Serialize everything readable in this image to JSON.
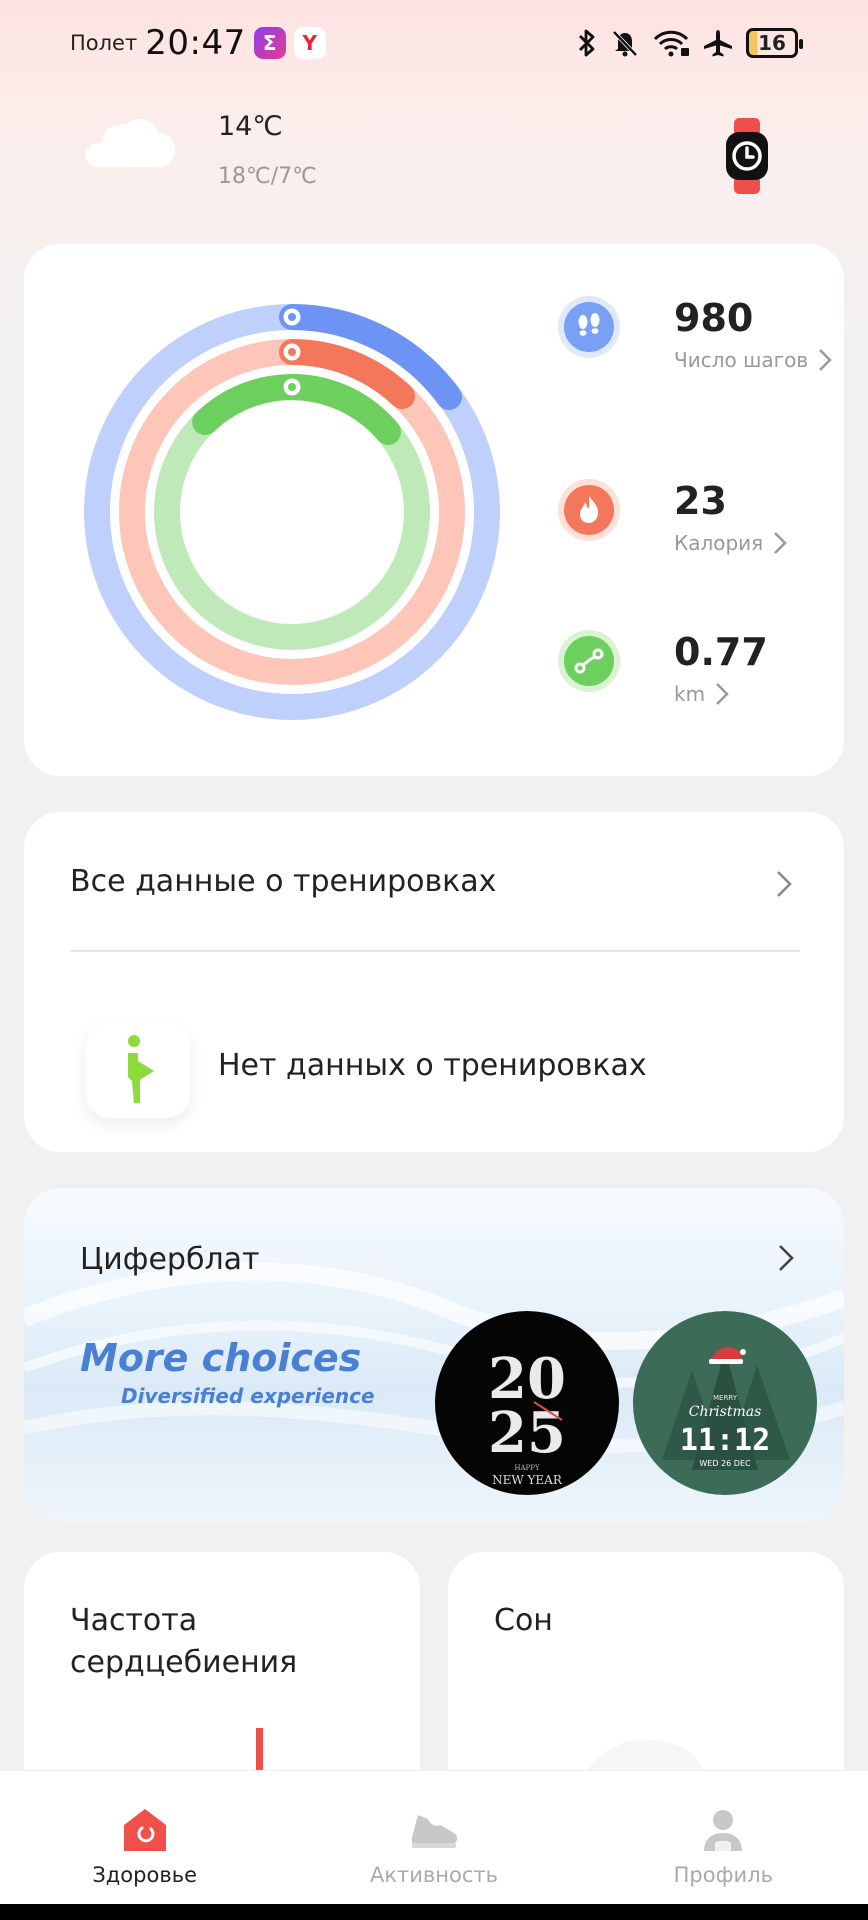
{
  "status_bar": {
    "carrier": "Полет",
    "time": "20:47",
    "app_badge_1": "Σ",
    "app_badge_2": "Y",
    "battery": "16"
  },
  "weather": {
    "current_temp": "14℃",
    "range": "18℃/7℃",
    "icon": "cloud-icon"
  },
  "activity": {
    "steps": {
      "value": "980",
      "label": "Число шагов",
      "icon": "footsteps-icon",
      "color": "#6d93f5"
    },
    "calories": {
      "value": "23",
      "label": "Калория",
      "icon": "flame-icon",
      "color": "#f4775c"
    },
    "distance": {
      "value": "0.77",
      "label": "km",
      "icon": "route-icon",
      "color": "#6ccf5e"
    }
  },
  "workouts": {
    "title": "Все данные о тренировках",
    "empty_text": "Нет данных о тренировках"
  },
  "watchface": {
    "title": "Циферблат",
    "promo_title": "More choices",
    "promo_subtitle": "Diversified experience",
    "face1": {
      "line1": "20",
      "line2": "25",
      "caption_small": "HAPPY",
      "caption": "NEW YEAR"
    },
    "face2": {
      "line1": "MERRY",
      "line2": "Christmas",
      "time": "11:12",
      "date": "WED 26 DEC"
    }
  },
  "heart_rate": {
    "title": "Частота сердцебиения"
  },
  "sleep": {
    "title": "Сон"
  },
  "nav": {
    "health": "Здоровье",
    "activity": "Активность",
    "profile": "Профиль"
  },
  "colors": {
    "accent": "#f0504a",
    "steps": "#6d93f5",
    "calories": "#f4775c",
    "distance": "#6ccf5e"
  }
}
